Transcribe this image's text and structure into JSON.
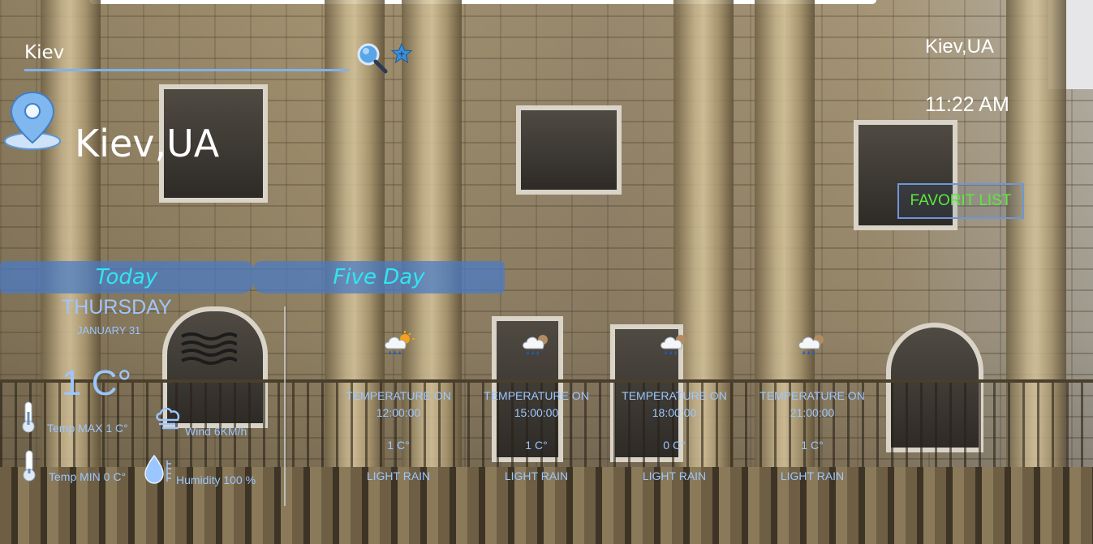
{
  "search": {
    "value": "Kiev"
  },
  "location": {
    "city": "Kiev,UA"
  },
  "header_right": {
    "city": "Kiev,UA",
    "time": "11:22 AM",
    "favorites_label": "FAVORIT LIST"
  },
  "tabs": [
    {
      "label": "Today"
    },
    {
      "label": "Five Day"
    }
  ],
  "today": {
    "day": "THURSDAY",
    "date": "JANUARY 31",
    "temp": "1 C°",
    "temp_max": "Temp MAX 1 C°",
    "temp_min": "Temp MIN 0 C°",
    "wind": "Wind 6KM/h",
    "humidity": "Humidity 100 %"
  },
  "forecast": [
    {
      "label": "TEMPERATURE ON",
      "time": "12:00:00",
      "temp": "1 C°",
      "desc": "LIGHT RAIN",
      "icon": "rain-sun-icon"
    },
    {
      "label": "TEMPERATURE ON",
      "time": "15:00:00",
      "temp": "1 C°",
      "desc": "LIGHT RAIN",
      "icon": "rain-cloud-icon"
    },
    {
      "label": "TEMPERATURE ON",
      "time": "18:00:00",
      "temp": "0 C°",
      "desc": "LIGHT RAIN",
      "icon": "rain-cloud-icon"
    },
    {
      "label": "TEMPERATURE ON",
      "time": "21:00:00",
      "temp": "1 C°",
      "desc": "LIGHT RAIN",
      "icon": "rain-cloud-icon"
    }
  ],
  "colors": {
    "accent": "#9cc6ff",
    "tab_text": "#30e6f0",
    "fav_text": "#5bea3c",
    "tab_bg": "#487cc8"
  }
}
